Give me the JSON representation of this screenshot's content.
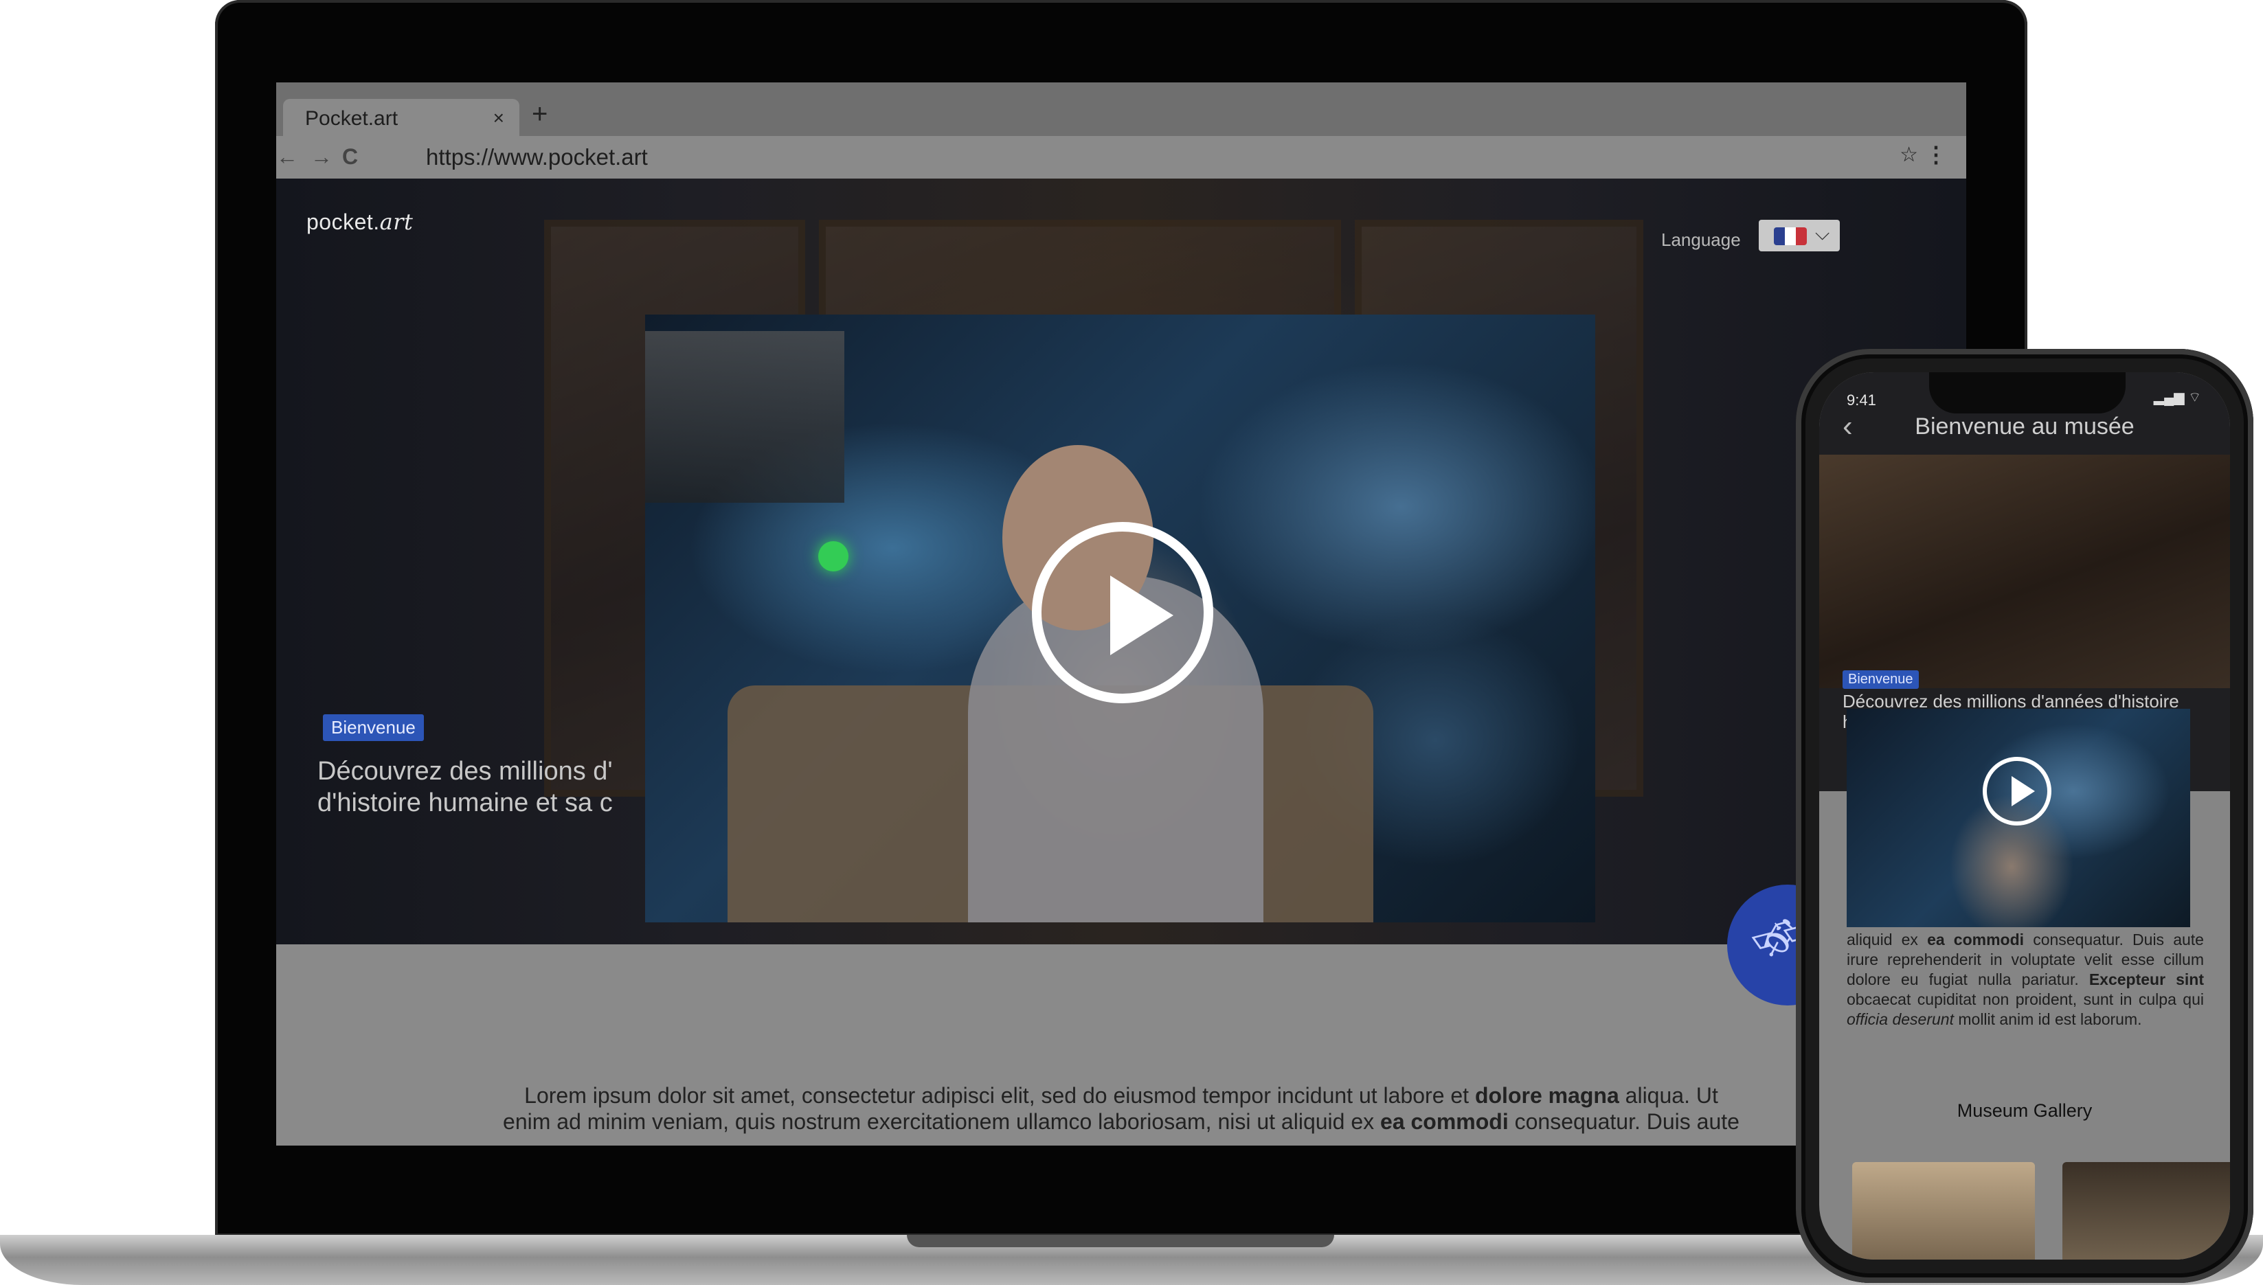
{
  "browser": {
    "tab_title": "Pocket.art",
    "tab_close": "×",
    "new_tab": "+",
    "back": "←",
    "forward": "→",
    "reload": "C",
    "url": "https://www.pocket.art",
    "star": "☆",
    "menu": "⋮"
  },
  "site": {
    "logo_main": "pocket.",
    "logo_accent": "art",
    "language_label": "Language",
    "flag_colors": [
      "#2a3f8f",
      "#ffffff",
      "#c8323a"
    ],
    "chevron": "⌵",
    "badge": "Bienvenue",
    "hero_text": "Découvrez des millions d'années d'histoire humaine et sa c",
    "hero_line2": "d'histoire humaine et sa c",
    "hero_line1": "Découvrez des millions d'",
    "fab_icon": "satellite-icon",
    "fab_glyph": "🛰",
    "body_p1_a": "Lorem ipsum dolor sit amet, consectetur adipisci elit, sed do eiusmod tempor incidunt ut labore et ",
    "body_p1_bold": "dolore magna",
    "body_p1_b": " aliqua. Ut",
    "body_p2_a": "enim ad minim veniam, quis nostrum exercitationem ullamco laboriosam, nisi ut aliquid ex ",
    "body_p2_bold": "ea commodi",
    "body_p2_b": " consequatur. Duis aute"
  },
  "phone": {
    "time": "9:41",
    "status_icons": "▂▄▆ ⌔",
    "back_glyph": "‹",
    "title": "Bienvenue au musée",
    "badge": "Bienvenue",
    "hero_text": "Découvrez des millions d'années d'histoire humaine et s",
    "body_a": "aliquid ex ",
    "body_bold1": "ea commodi",
    "body_b": " consequatur. Duis aute irure reprehenderit in voluptate velit esse cillum dolore eu fugiat nulla pariatur. ",
    "body_bold2": "Excepteur sint",
    "body_c": " obcaecat cupiditat non proident, sunt in culpa qui ",
    "body_italic": "officia deserunt",
    "body_d": " mollit anim id est laborum.",
    "gallery_title": "Museum Gallery"
  }
}
